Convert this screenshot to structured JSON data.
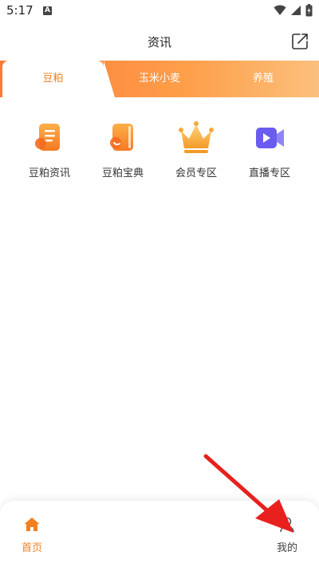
{
  "status_bar": {
    "time": "5:17",
    "notif_letter": "A"
  },
  "header": {
    "title": "资讯"
  },
  "tabs": [
    {
      "label": "豆粕",
      "active": true
    },
    {
      "label": "玉米小麦",
      "active": false
    },
    {
      "label": "养殖",
      "active": false
    }
  ],
  "grid": [
    {
      "label": "豆粕资讯",
      "icon": "document-icon"
    },
    {
      "label": "豆粕宝典",
      "icon": "book-icon"
    },
    {
      "label": "会员专区",
      "icon": "crown-icon"
    },
    {
      "label": "直播专区",
      "icon": "video-camera-icon"
    }
  ],
  "bottom_nav": [
    {
      "label": "首页",
      "icon": "home-icon",
      "active": true
    },
    {
      "label": "我的",
      "icon": "user-icon",
      "active": false
    }
  ],
  "colors": {
    "accent": "#f2801e",
    "tab_gradient_start": "#fd7a35",
    "tab_gradient_end": "#fbc07d",
    "annotation": "#e8201e"
  }
}
